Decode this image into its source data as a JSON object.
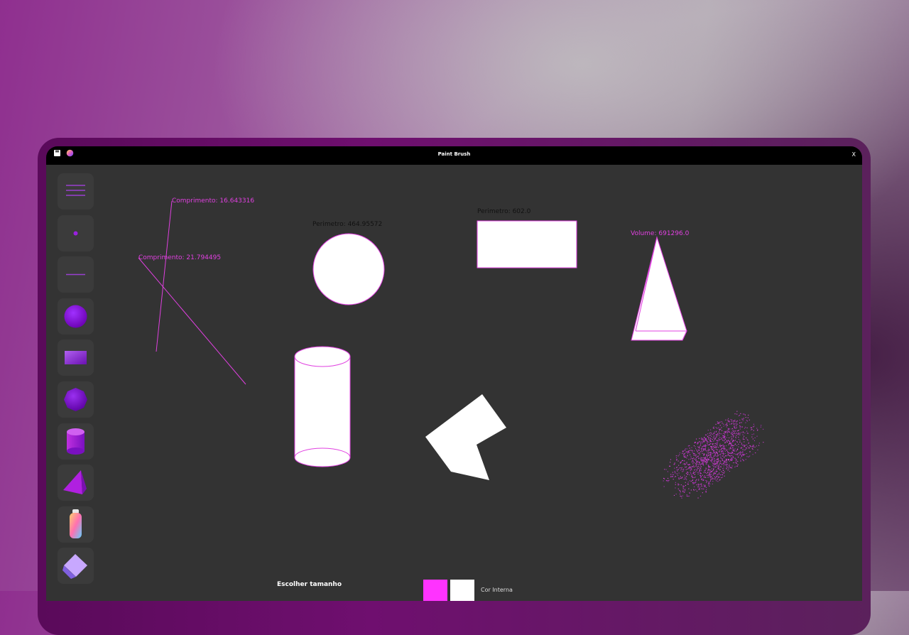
{
  "window": {
    "title": "Paint Brush",
    "close_label": "X"
  },
  "titlebar_icons": [
    "save-icon",
    "color-palette-icon"
  ],
  "toolbar": {
    "tools": [
      {
        "name": "menu-lines-tool",
        "icon": "menu-lines-icon"
      },
      {
        "name": "point-tool",
        "icon": "dot-icon"
      },
      {
        "name": "line-tool",
        "icon": "line-icon"
      },
      {
        "name": "circle-tool",
        "icon": "circle-icon"
      },
      {
        "name": "rectangle-tool",
        "icon": "rectangle-icon"
      },
      {
        "name": "polygon-tool",
        "icon": "polygon-icon"
      },
      {
        "name": "cylinder-tool",
        "icon": "cylinder-icon"
      },
      {
        "name": "pyramid-tool",
        "icon": "pyramid-icon"
      },
      {
        "name": "spray-tool",
        "icon": "spray-can-icon"
      },
      {
        "name": "eraser-tool",
        "icon": "eraser-icon"
      }
    ]
  },
  "canvas": {
    "line1_label": "Comprimento: 16.643316",
    "line2_label": "Comprimento: 21.794495",
    "circle_label": "Perimetro: 464.95572",
    "rect_label": "Perimetro: 602.0",
    "pyramid_label": "Volume: 691296.0"
  },
  "bottom": {
    "size_label": "Escolher tamanho",
    "fill_label": "Cor Interna",
    "stroke_color": "#ff33ff",
    "fill_color": "#ffffff"
  },
  "colors": {
    "accent": "#e040e0",
    "canvas_bg": "#333333",
    "shape_fill": "#ffffff"
  }
}
